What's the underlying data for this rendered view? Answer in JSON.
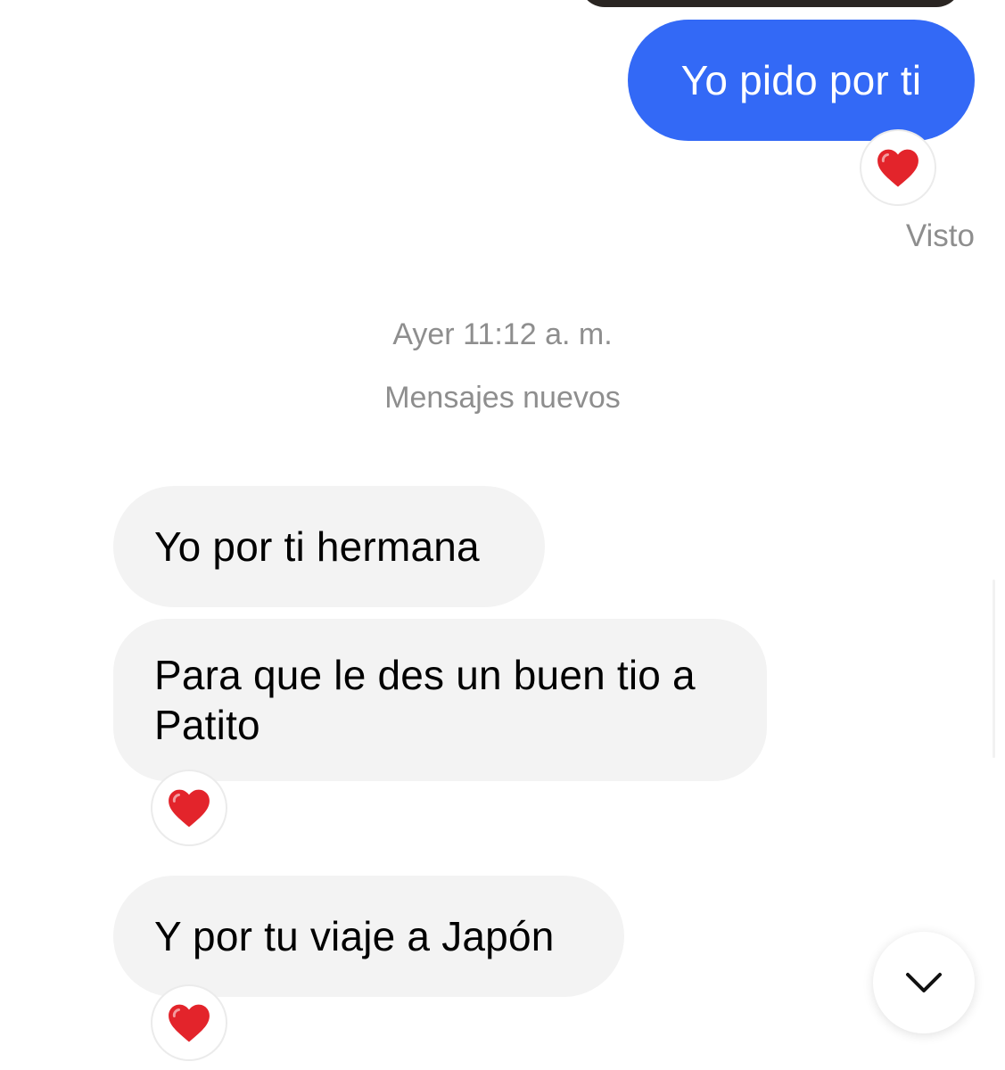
{
  "colors": {
    "sent_bubble": "#3369F6",
    "received_bubble": "#F3F3F3",
    "meta_text": "#8E8E8E",
    "heart": "#E3242B"
  },
  "messages": [
    {
      "direction": "sent",
      "text": "Yo pido por ti",
      "reaction": "❤️"
    },
    {
      "direction": "received",
      "text": "Yo por ti hermana"
    },
    {
      "direction": "received",
      "text": "Para que le des un buen tio a Patito",
      "reaction": "❤️"
    },
    {
      "direction": "received",
      "text": "Y por tu viaje a Japón",
      "reaction": "❤️"
    }
  ],
  "status": "Visto",
  "timestamp": "Ayer 11:12 a. m.",
  "divider_label": "Mensajes nuevos",
  "scroll_button": {
    "icon": "chevron-down-icon"
  }
}
